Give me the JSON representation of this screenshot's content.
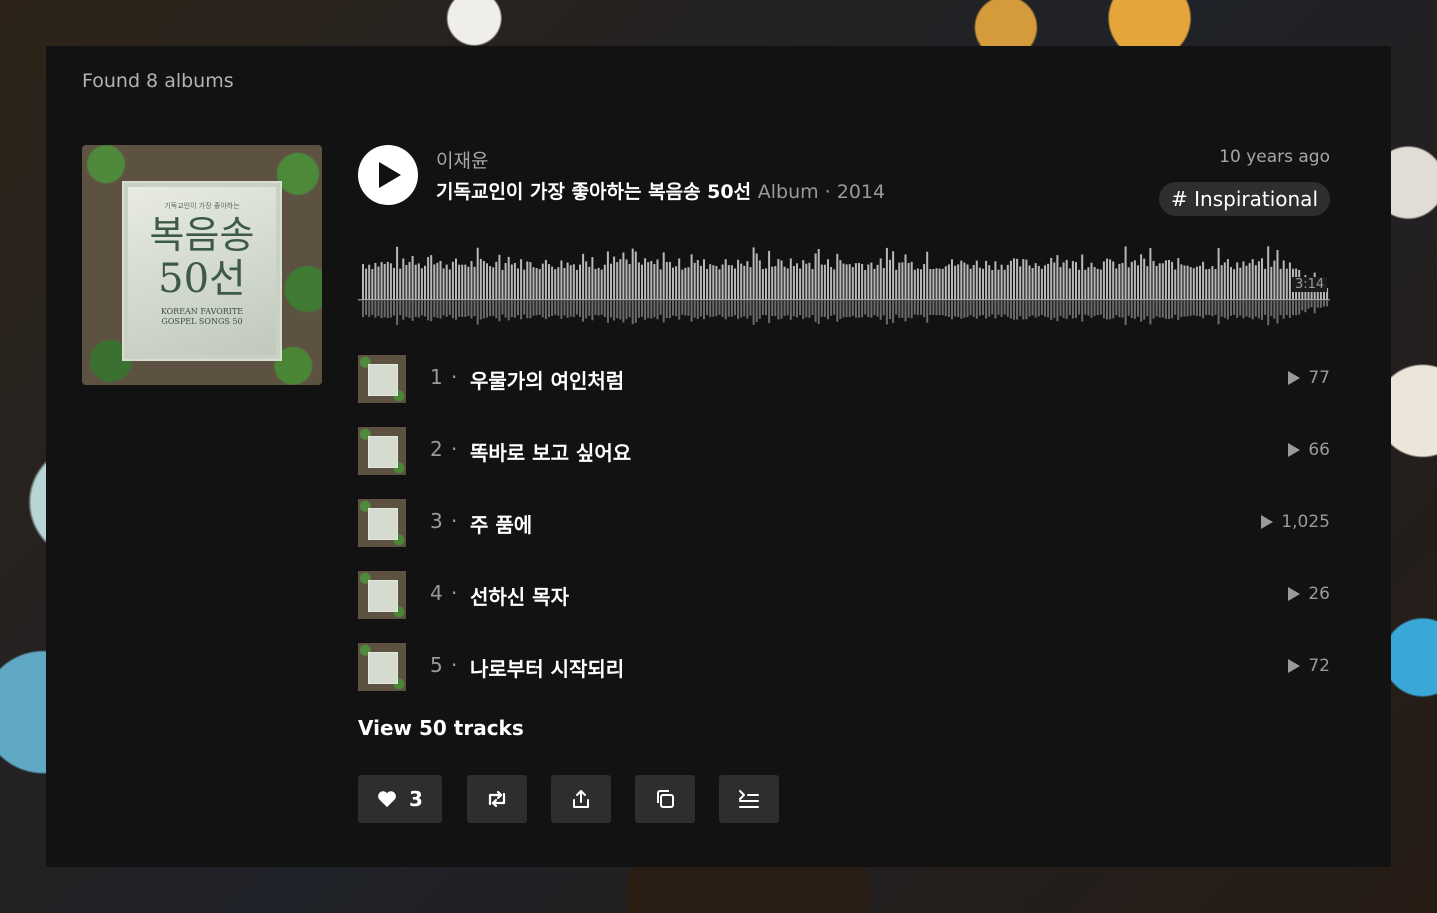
{
  "results": {
    "found_label": "Found 8 albums"
  },
  "album": {
    "artist": "이재윤",
    "title": "기독교인이 가장 좋아하는 복음송 50선",
    "type_year": "Album · 2014",
    "date": "10 years ago",
    "tag": "# Inspirational",
    "duration": "3:14",
    "cover": {
      "subtitle": "기독교인이 가장 좋아하는",
      "line1": "복음송",
      "line2": "50선",
      "english1": "KOREAN FAVORITE",
      "english2": "GOSPEL SONGS 50"
    }
  },
  "tracks": [
    {
      "num": "1",
      "title": "우물가의 여인처럼",
      "plays": "77"
    },
    {
      "num": "2",
      "title": "똑바로 보고 싶어요",
      "plays": "66"
    },
    {
      "num": "3",
      "title": "주 품에",
      "plays": "1,025"
    },
    {
      "num": "4",
      "title": "선하신 목자",
      "plays": "26"
    },
    {
      "num": "5",
      "title": "나로부터 시작되리",
      "plays": "72"
    }
  ],
  "view_tracks_label": "View 50 tracks",
  "actions": {
    "like_count": "3"
  },
  "icons": {
    "play": "play-icon",
    "like": "heart-icon",
    "repost": "repost-icon",
    "share": "share-icon",
    "copy": "copy-link-icon",
    "queue": "add-to-queue-icon"
  },
  "colors": {
    "panel": "#121212",
    "text_muted": "#a7a7a7",
    "button_bg": "#2e2e2e"
  }
}
